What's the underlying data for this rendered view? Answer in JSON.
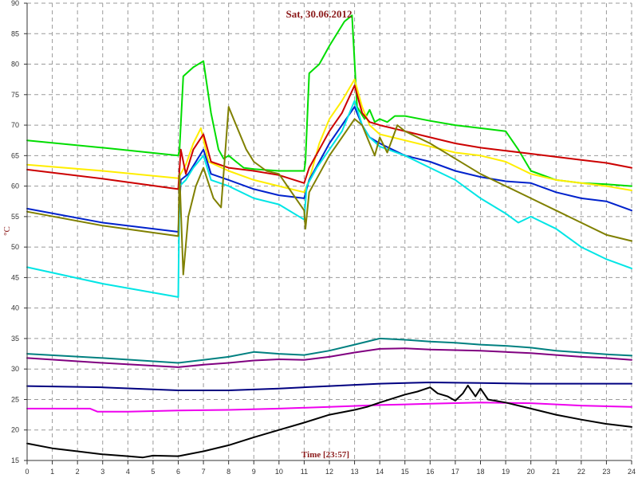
{
  "chart_data": {
    "type": "line",
    "title": "Sat, 30.06.2012",
    "xlabel": "Time [23:57]",
    "ylabel": "°C",
    "xlim": [
      0,
      24
    ],
    "ylim": [
      15,
      90
    ],
    "x_ticks": [
      "0",
      "1",
      "2",
      "3",
      "4",
      "5",
      "6",
      "7",
      "8",
      "9",
      "10",
      "11",
      "12",
      "13",
      "14",
      "15",
      "16",
      "17",
      "18",
      "19",
      "20",
      "21",
      "22",
      "23",
      "24"
    ],
    "y_ticks": [
      "15",
      "20",
      "25",
      "30",
      "35",
      "40",
      "45",
      "50",
      "55",
      "60",
      "65",
      "70",
      "75",
      "80",
      "85",
      "90"
    ],
    "grid": true,
    "series": [
      {
        "color": "#00dd00",
        "points": [
          [
            0,
            67.5
          ],
          [
            3,
            66.3
          ],
          [
            6,
            65
          ],
          [
            6.05,
            66
          ],
          [
            6.2,
            78
          ],
          [
            6.6,
            79.5
          ],
          [
            7,
            80.5
          ],
          [
            7.3,
            72
          ],
          [
            7.6,
            66
          ],
          [
            7.8,
            64.5
          ],
          [
            8,
            65
          ],
          [
            8.3,
            64
          ],
          [
            8.6,
            63
          ],
          [
            9,
            62.8
          ],
          [
            10,
            62.5
          ],
          [
            11,
            62.5
          ],
          [
            11.05,
            64
          ],
          [
            11.2,
            78.5
          ],
          [
            11.6,
            80
          ],
          [
            12,
            83
          ],
          [
            12.6,
            87
          ],
          [
            12.9,
            88
          ],
          [
            13.1,
            73
          ],
          [
            13.4,
            71
          ],
          [
            13.6,
            72.5
          ],
          [
            13.8,
            70.5
          ],
          [
            14,
            71
          ],
          [
            14.3,
            70.5
          ],
          [
            14.6,
            71.5
          ],
          [
            15,
            71.5
          ],
          [
            16,
            70.7
          ],
          [
            17,
            70
          ],
          [
            18,
            69.5
          ],
          [
            19,
            69
          ],
          [
            19.5,
            66
          ],
          [
            20,
            62.5
          ],
          [
            21,
            61
          ],
          [
            22,
            60.5
          ],
          [
            23,
            60.3
          ],
          [
            24,
            60
          ]
        ]
      },
      {
        "color": "#ffee00",
        "points": [
          [
            0,
            63.5
          ],
          [
            3,
            62.5
          ],
          [
            6,
            61.3
          ],
          [
            6.3,
            63.5
          ],
          [
            6.6,
            67
          ],
          [
            6.9,
            69.5
          ],
          [
            7.2,
            64
          ],
          [
            8,
            62.5
          ],
          [
            9,
            61
          ],
          [
            10,
            60
          ],
          [
            11,
            59
          ],
          [
            11.2,
            61
          ],
          [
            11.6,
            67
          ],
          [
            12,
            71
          ],
          [
            12.5,
            74
          ],
          [
            13,
            77.5
          ],
          [
            13.3,
            73
          ],
          [
            13.6,
            70
          ],
          [
            14,
            68.5
          ],
          [
            15,
            67.5
          ],
          [
            16,
            66.5
          ],
          [
            17,
            65.5
          ],
          [
            18,
            65
          ],
          [
            19,
            64
          ],
          [
            20,
            62
          ],
          [
            21,
            61
          ],
          [
            22,
            60.5
          ],
          [
            23,
            60
          ],
          [
            24,
            59.3
          ]
        ]
      },
      {
        "color": "#cc0000",
        "points": [
          [
            0,
            62.7
          ],
          [
            3,
            61.2
          ],
          [
            6,
            59.5
          ],
          [
            6.1,
            66
          ],
          [
            6.3,
            62
          ],
          [
            6.6,
            66
          ],
          [
            7,
            68.5
          ],
          [
            7.3,
            64
          ],
          [
            8,
            63
          ],
          [
            9,
            62.5
          ],
          [
            10,
            61.8
          ],
          [
            11,
            60.5
          ],
          [
            11.2,
            63
          ],
          [
            11.6,
            66
          ],
          [
            12,
            69
          ],
          [
            12.5,
            72
          ],
          [
            13,
            76.5
          ],
          [
            13.3,
            72
          ],
          [
            13.6,
            70.5
          ],
          [
            14,
            70
          ],
          [
            15,
            69
          ],
          [
            16,
            68
          ],
          [
            17,
            67
          ],
          [
            18,
            66.3
          ],
          [
            19,
            65.8
          ],
          [
            20,
            65.3
          ],
          [
            21,
            64.8
          ],
          [
            22,
            64.3
          ],
          [
            23,
            63.8
          ],
          [
            24,
            63
          ]
        ]
      },
      {
        "color": "#0022cc",
        "points": [
          [
            0,
            56.3
          ],
          [
            3,
            54
          ],
          [
            6,
            52.5
          ],
          [
            6.1,
            61
          ],
          [
            6.4,
            62
          ],
          [
            6.7,
            64
          ],
          [
            7,
            66
          ],
          [
            7.3,
            62
          ],
          [
            8,
            61
          ],
          [
            9,
            59.5
          ],
          [
            10,
            58.5
          ],
          [
            11,
            58
          ],
          [
            11.2,
            61
          ],
          [
            11.6,
            64
          ],
          [
            12,
            67
          ],
          [
            12.5,
            70
          ],
          [
            13,
            73
          ],
          [
            13.3,
            70
          ],
          [
            13.6,
            68
          ],
          [
            14,
            67
          ],
          [
            15,
            65
          ],
          [
            16,
            64
          ],
          [
            17,
            62.5
          ],
          [
            18,
            61.5
          ],
          [
            19,
            60.8
          ],
          [
            20,
            60.5
          ],
          [
            21,
            59
          ],
          [
            22,
            58
          ],
          [
            23,
            57.5
          ],
          [
            24,
            56
          ]
        ]
      },
      {
        "color": "#00e5e5",
        "points": [
          [
            0,
            46.7
          ],
          [
            3,
            44
          ],
          [
            6,
            41.8
          ],
          [
            6.05,
            60
          ],
          [
            6.3,
            61
          ],
          [
            6.6,
            63
          ],
          [
            7,
            65
          ],
          [
            7.3,
            61
          ],
          [
            8,
            60
          ],
          [
            9,
            58
          ],
          [
            10,
            57
          ],
          [
            11,
            54.5
          ],
          [
            11.1,
            60
          ],
          [
            11.5,
            63
          ],
          [
            12,
            66
          ],
          [
            12.5,
            69
          ],
          [
            13,
            74
          ],
          [
            13.3,
            70
          ],
          [
            13.6,
            68
          ],
          [
            14,
            66.5
          ],
          [
            15,
            65
          ],
          [
            16,
            63
          ],
          [
            17,
            61
          ],
          [
            18,
            58
          ],
          [
            19,
            55.5
          ],
          [
            19.5,
            54
          ],
          [
            20,
            55
          ],
          [
            21,
            53
          ],
          [
            22,
            50
          ],
          [
            23,
            48
          ],
          [
            24,
            46.5
          ]
        ]
      },
      {
        "color": "#808000",
        "points": [
          [
            0,
            55.8
          ],
          [
            3,
            53.5
          ],
          [
            6,
            51.8
          ],
          [
            6.05,
            62
          ],
          [
            6.2,
            45.5
          ],
          [
            6.4,
            55
          ],
          [
            6.7,
            60
          ],
          [
            7,
            63
          ],
          [
            7.4,
            58
          ],
          [
            7.7,
            56.5
          ],
          [
            8,
            73
          ],
          [
            8.3,
            70
          ],
          [
            8.7,
            66
          ],
          [
            9,
            64
          ],
          [
            9.5,
            62.5
          ],
          [
            10,
            62
          ],
          [
            11,
            56
          ],
          [
            11.05,
            53
          ],
          [
            11.2,
            59
          ],
          [
            11.6,
            62
          ],
          [
            12,
            65
          ],
          [
            12.5,
            68
          ],
          [
            13,
            71
          ],
          [
            13.3,
            70
          ],
          [
            13.6,
            67
          ],
          [
            13.8,
            65
          ],
          [
            14,
            68
          ],
          [
            14.3,
            65.5
          ],
          [
            14.7,
            70
          ],
          [
            15,
            69
          ],
          [
            16,
            67
          ],
          [
            17,
            64.5
          ],
          [
            18,
            62
          ],
          [
            19,
            60
          ],
          [
            20,
            58
          ],
          [
            21,
            56
          ],
          [
            22,
            54
          ],
          [
            23,
            52
          ],
          [
            24,
            51
          ]
        ]
      },
      {
        "color": "#008080",
        "points": [
          [
            0,
            32.5
          ],
          [
            3,
            31.8
          ],
          [
            6,
            31
          ],
          [
            7,
            31.5
          ],
          [
            8,
            32
          ],
          [
            9,
            32.8
          ],
          [
            10,
            32.5
          ],
          [
            11,
            32.3
          ],
          [
            12,
            33
          ],
          [
            13,
            34
          ],
          [
            14,
            35
          ],
          [
            15,
            34.8
          ],
          [
            16,
            34.5
          ],
          [
            17,
            34.3
          ],
          [
            18,
            34
          ],
          [
            19,
            33.8
          ],
          [
            20,
            33.5
          ],
          [
            21,
            33
          ],
          [
            22,
            32.7
          ],
          [
            23,
            32.4
          ],
          [
            24,
            32.2
          ]
        ]
      },
      {
        "color": "#800080",
        "points": [
          [
            0,
            31.8
          ],
          [
            3,
            31
          ],
          [
            6,
            30.3
          ],
          [
            7,
            30.7
          ],
          [
            8,
            31
          ],
          [
            9,
            31.4
          ],
          [
            10,
            31.6
          ],
          [
            11,
            31.5
          ],
          [
            12,
            32
          ],
          [
            13,
            32.7
          ],
          [
            14,
            33.3
          ],
          [
            15,
            33.4
          ],
          [
            16,
            33.2
          ],
          [
            17,
            33.1
          ],
          [
            18,
            33
          ],
          [
            19,
            32.8
          ],
          [
            20,
            32.6
          ],
          [
            21,
            32.3
          ],
          [
            22,
            32
          ],
          [
            23,
            31.8
          ],
          [
            24,
            31.5
          ]
        ]
      },
      {
        "color": "#000080",
        "points": [
          [
            0,
            27.2
          ],
          [
            3,
            27
          ],
          [
            6,
            26.5
          ],
          [
            8,
            26.5
          ],
          [
            10,
            26.8
          ],
          [
            12,
            27.2
          ],
          [
            14,
            27.6
          ],
          [
            16,
            27.8
          ],
          [
            18,
            27.7
          ],
          [
            20,
            27.6
          ],
          [
            22,
            27.6
          ],
          [
            24,
            27.6
          ]
        ]
      },
      {
        "color": "#ee00ee",
        "points": [
          [
            0,
            23.5
          ],
          [
            2.5,
            23.5
          ],
          [
            2.8,
            23
          ],
          [
            4,
            23
          ],
          [
            6,
            23.2
          ],
          [
            8,
            23.3
          ],
          [
            10,
            23.5
          ],
          [
            12,
            23.8
          ],
          [
            14,
            24.1
          ],
          [
            16,
            24.3
          ],
          [
            18,
            24.5
          ],
          [
            20,
            24.4
          ],
          [
            22,
            24
          ],
          [
            24,
            23.8
          ]
        ]
      },
      {
        "color": "#000000",
        "points": [
          [
            0,
            17.8
          ],
          [
            1,
            17
          ],
          [
            2,
            16.5
          ],
          [
            3,
            16
          ],
          [
            4,
            15.7
          ],
          [
            4.6,
            15.5
          ],
          [
            5,
            15.8
          ],
          [
            6,
            15.7
          ],
          [
            7,
            16.5
          ],
          [
            8,
            17.5
          ],
          [
            9,
            18.8
          ],
          [
            10,
            20
          ],
          [
            11,
            21.2
          ],
          [
            12,
            22.5
          ],
          [
            13,
            23.3
          ],
          [
            13.5,
            23.8
          ],
          [
            14,
            24.5
          ],
          [
            15,
            25.8
          ],
          [
            15.5,
            26.3
          ],
          [
            16,
            27
          ],
          [
            16.3,
            26
          ],
          [
            16.7,
            25.5
          ],
          [
            17,
            24.8
          ],
          [
            17.3,
            26
          ],
          [
            17.5,
            27.3
          ],
          [
            17.8,
            25.5
          ],
          [
            18,
            26.8
          ],
          [
            18.3,
            25
          ],
          [
            19,
            24.5
          ],
          [
            20,
            23.5
          ],
          [
            21,
            22.5
          ],
          [
            22,
            21.7
          ],
          [
            23,
            21
          ],
          [
            24,
            20.5
          ]
        ]
      }
    ]
  }
}
